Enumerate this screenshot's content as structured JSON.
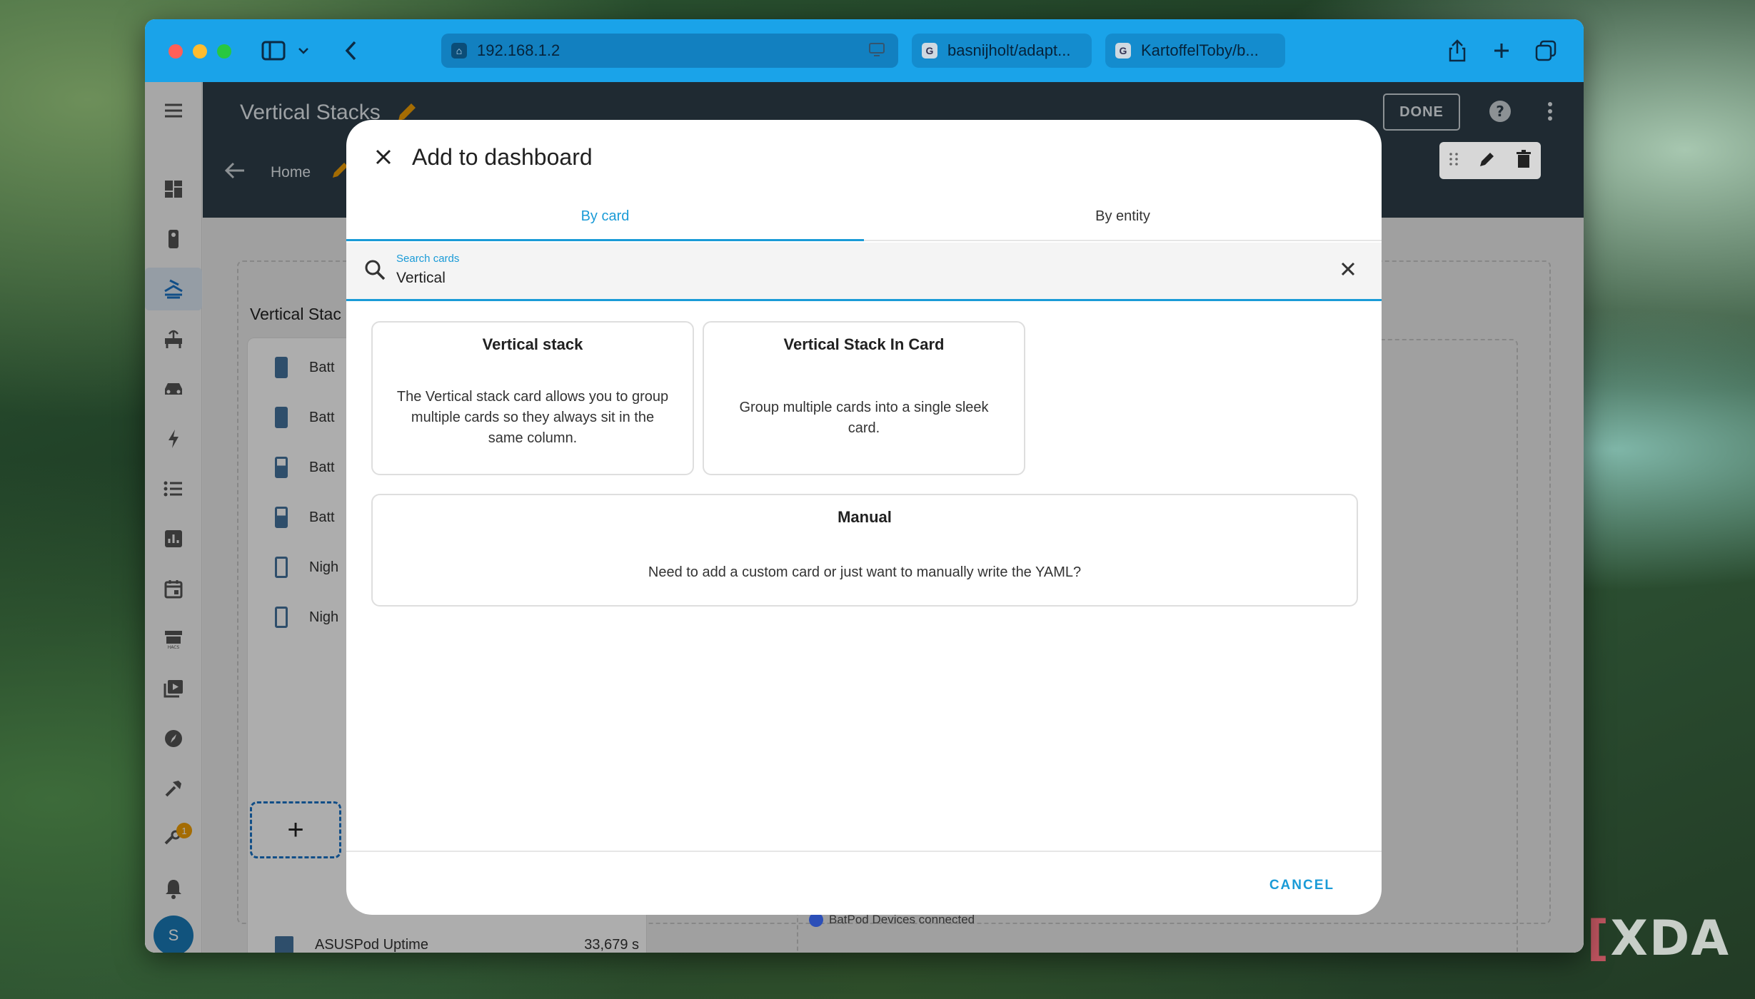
{
  "browser": {
    "tabs": [
      {
        "label": "192.168.1.2",
        "favicon": "home-assistant-icon"
      },
      {
        "label": "basnijholt/adapt...",
        "favicon": "github-icon"
      },
      {
        "label": "KartoffelToby/b...",
        "favicon": "github-icon"
      }
    ]
  },
  "ha": {
    "dashboard_title": "Vertical Stacks",
    "done_label": "DONE",
    "home_tab": "Home",
    "avatar_initial": "S",
    "notification_badge": "1",
    "background": {
      "section_title": "Vertical Stac",
      "rows": [
        "Batt",
        "Batt",
        "Batt",
        "Batt",
        "Nigh",
        "Nigh"
      ],
      "bottom_row_label": "ASUSPod Uptime",
      "bottom_row_value": "33,679 s",
      "legend_label": "BatPod Devices connected"
    }
  },
  "dialog": {
    "title": "Add to dashboard",
    "tabs": [
      "By card",
      "By entity"
    ],
    "search": {
      "label": "Search cards",
      "value": "Vertical"
    },
    "cards": [
      {
        "title": "Vertical stack",
        "description": "The Vertical stack card allows you to group multiple cards so they always sit in the same column."
      },
      {
        "title": "Vertical Stack In Card",
        "description": "Group multiple cards into a single sleek card."
      }
    ],
    "manual": {
      "title": "Manual",
      "description": "Need to add a custom card or just want to manually write the YAML?"
    },
    "cancel_label": "CANCEL"
  },
  "colors": {
    "titlebar": "#1aa3e9",
    "accent": "#1a9bd7",
    "header": "#2f3e4a"
  },
  "watermark": "XDA"
}
